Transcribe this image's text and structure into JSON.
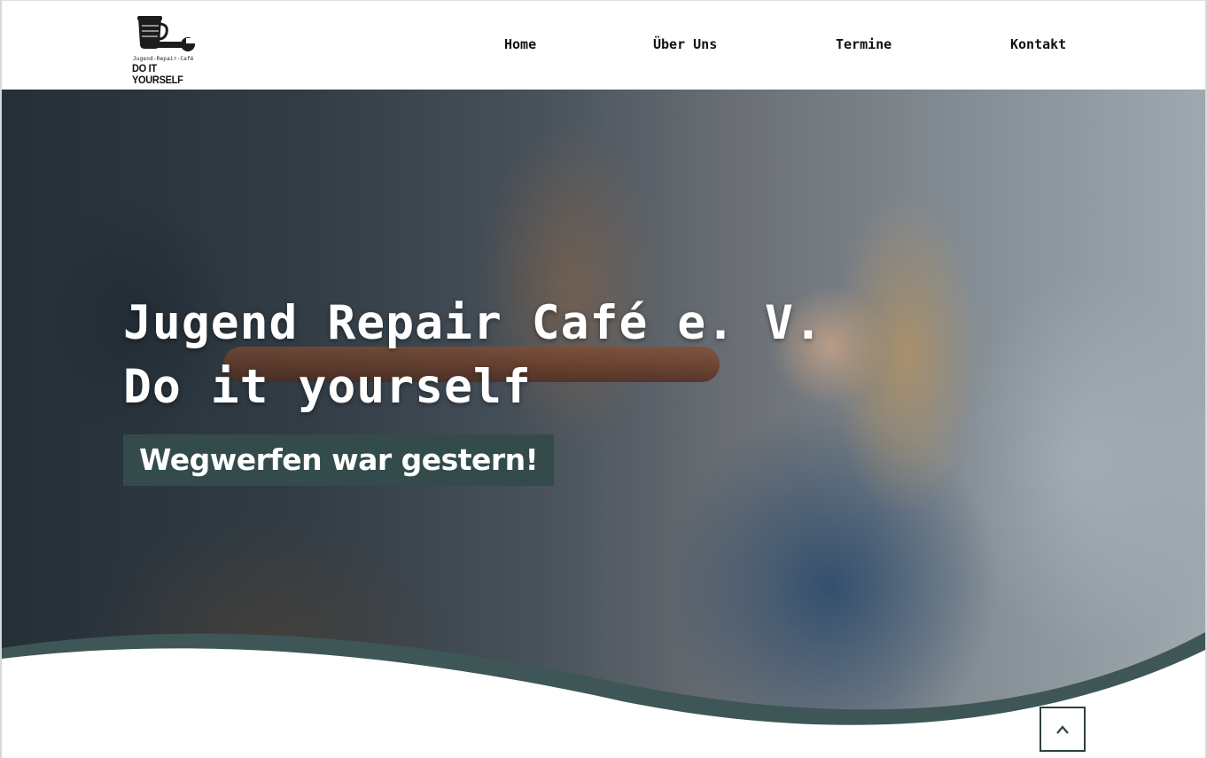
{
  "logo": {
    "subtitle": "Jugend-Repair-Café",
    "title": "DO IT YOURSELF",
    "icon": "coffee-cup-wrench-icon"
  },
  "nav": {
    "items": [
      {
        "label": "Home"
      },
      {
        "label": "Über Uns"
      },
      {
        "label": "Termine"
      },
      {
        "label": "Kontakt"
      }
    ]
  },
  "hero": {
    "title_line1": "Jugend Repair Café e. V.",
    "title_line2": "Do it yourself",
    "tagline": "Wegwerfen war gestern!"
  },
  "scroll_top": {
    "icon": "chevron-up-icon"
  },
  "colors": {
    "accent": "#344b4b",
    "wave": "#3e5656",
    "text_dark": "#111111",
    "background": "#ffffff"
  }
}
